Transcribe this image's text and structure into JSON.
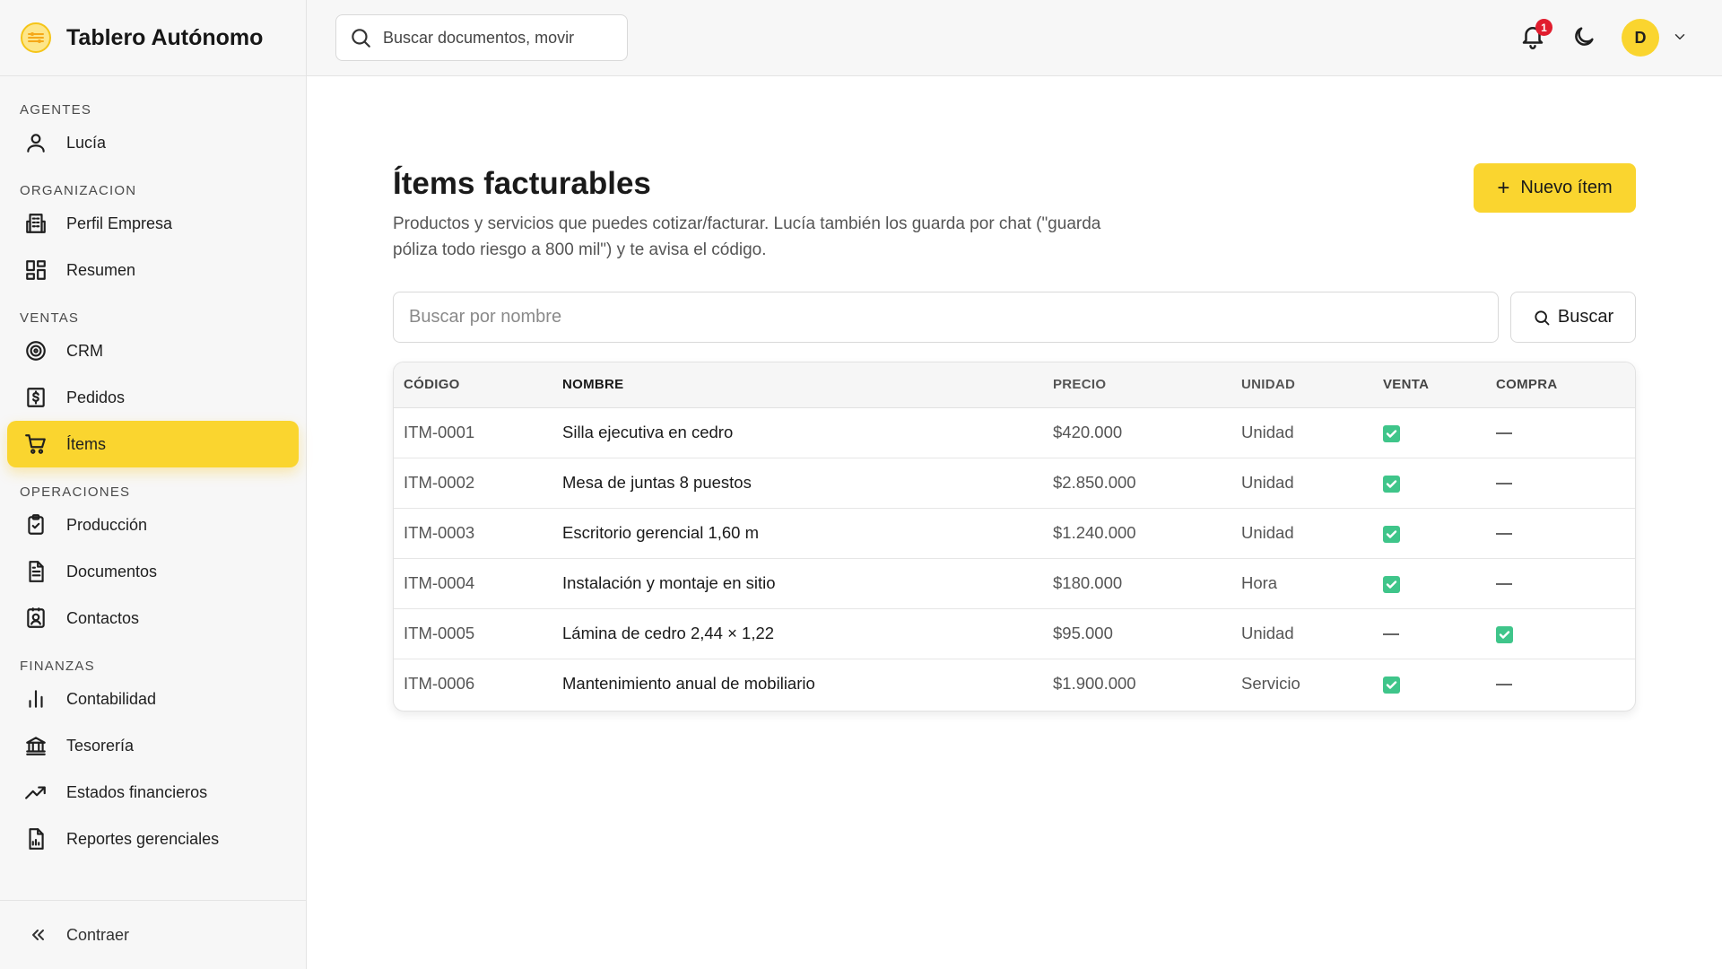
{
  "app": {
    "title": "Tablero Autónomo"
  },
  "search": {
    "placeholder": "Buscar documentos, movir"
  },
  "notifications": {
    "count": "1"
  },
  "user": {
    "initial": "D"
  },
  "sidebar": {
    "sections": [
      {
        "label": "AGENTES",
        "items": [
          {
            "label": "Lucía",
            "icon": "user-icon"
          }
        ]
      },
      {
        "label": "ORGANIZACION",
        "items": [
          {
            "label": "Perfil Empresa",
            "icon": "building-icon"
          },
          {
            "label": "Resumen",
            "icon": "dashboard-icon"
          }
        ]
      },
      {
        "label": "VENTAS",
        "items": [
          {
            "label": "CRM",
            "icon": "target-icon"
          },
          {
            "label": "Pedidos",
            "icon": "receipt-icon"
          },
          {
            "label": "Ítems",
            "icon": "cart-icon",
            "active": true
          }
        ]
      },
      {
        "label": "OPERACIONES",
        "items": [
          {
            "label": "Producción",
            "icon": "clipboard-check-icon"
          },
          {
            "label": "Documentos",
            "icon": "document-icon"
          },
          {
            "label": "Contactos",
            "icon": "contact-icon"
          }
        ]
      },
      {
        "label": "FINANZAS",
        "items": [
          {
            "label": "Contabilidad",
            "icon": "bar-chart-icon"
          },
          {
            "label": "Tesorería",
            "icon": "bank-icon"
          },
          {
            "label": "Estados financieros",
            "icon": "trending-up-icon"
          },
          {
            "label": "Reportes gerenciales",
            "icon": "report-icon"
          }
        ]
      }
    ],
    "collapse_label": "Contraer"
  },
  "page": {
    "title": "Ítems facturables",
    "description": "Productos y servicios que puedes cotizar/facturar. Lucía también los guarda por chat (\"guarda póliza todo riesgo a 800 mil\") y te avisa el código.",
    "new_button": "Nuevo ítem",
    "filter_placeholder": "Buscar por nombre",
    "filter_button": "Buscar"
  },
  "table": {
    "columns": [
      "CÓDIGO",
      "NOMBRE",
      "PRECIO",
      "UNIDAD",
      "VENTA",
      "COMPRA"
    ],
    "rows": [
      {
        "code": "ITM-0001",
        "name": "Silla ejecutiva en cedro",
        "price": "$420.000",
        "unit": "Unidad",
        "venta": true,
        "compra": false
      },
      {
        "code": "ITM-0002",
        "name": "Mesa de juntas 8 puestos",
        "price": "$2.850.000",
        "unit": "Unidad",
        "venta": true,
        "compra": false
      },
      {
        "code": "ITM-0003",
        "name": "Escritorio gerencial 1,60 m",
        "price": "$1.240.000",
        "unit": "Unidad",
        "venta": true,
        "compra": false
      },
      {
        "code": "ITM-0004",
        "name": "Instalación y montaje en sitio",
        "price": "$180.000",
        "unit": "Hora",
        "venta": true,
        "compra": false
      },
      {
        "code": "ITM-0005",
        "name": "Lámina de cedro 2,44 × 1,22",
        "price": "$95.000",
        "unit": "Unidad",
        "venta": false,
        "compra": true
      },
      {
        "code": "ITM-0006",
        "name": "Mantenimiento anual de mobiliario",
        "price": "$1.900.000",
        "unit": "Servicio",
        "venta": true,
        "compra": false
      }
    ]
  },
  "colors": {
    "accent": "#fad52f",
    "check": "#3fc58a",
    "badge": "#e11d2e"
  }
}
